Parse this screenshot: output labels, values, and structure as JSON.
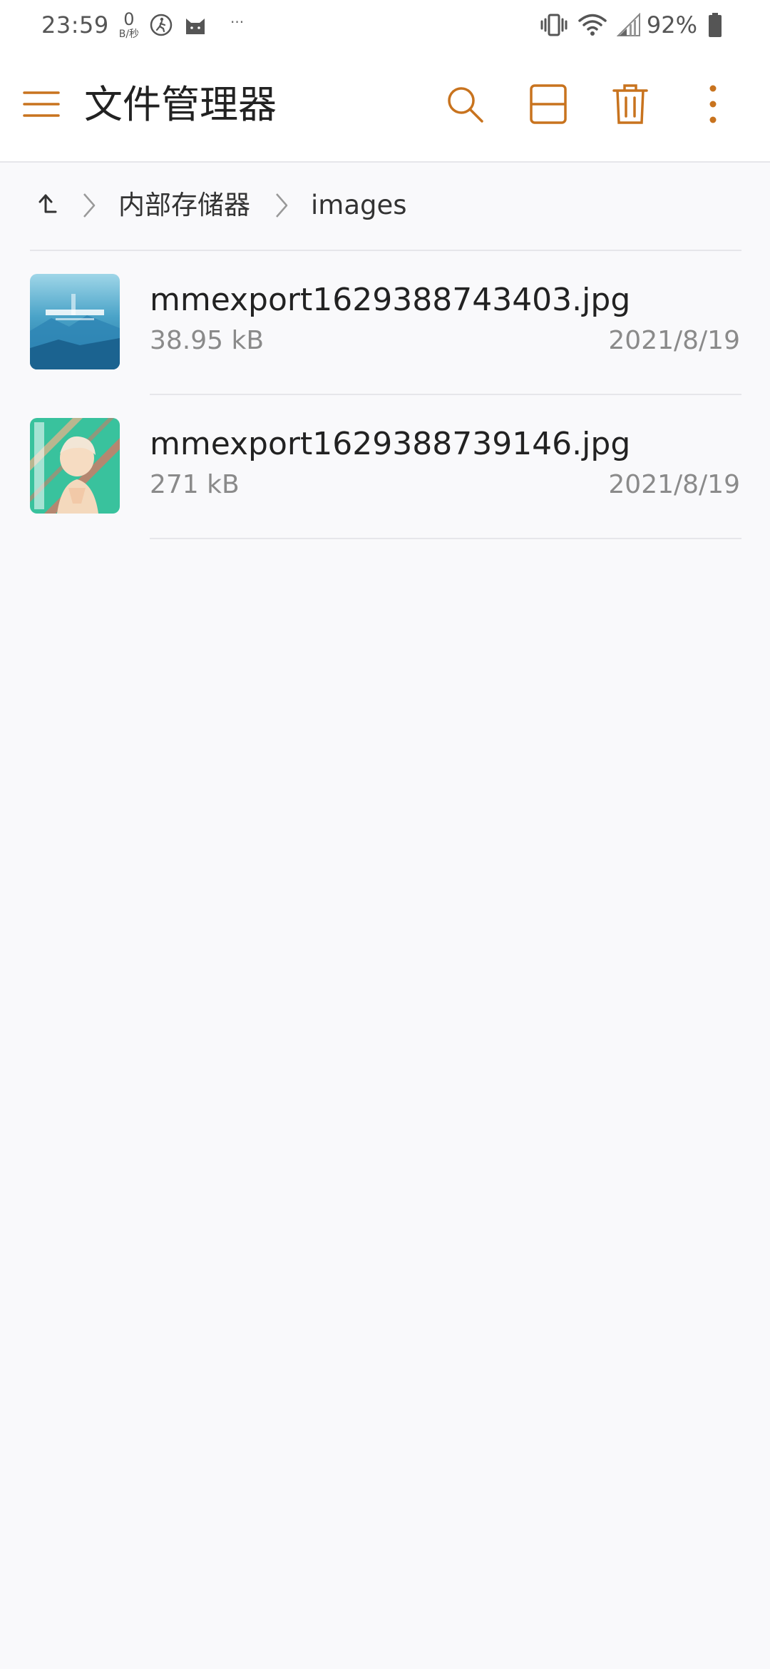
{
  "status_bar": {
    "time": "23:59",
    "net_speed_value": "0",
    "net_speed_unit": "B/秒",
    "more_dots": "···",
    "battery_percent": "92%"
  },
  "app_bar": {
    "title": "文件管理器"
  },
  "breadcrumb": {
    "items": [
      "内部存储器",
      "images"
    ]
  },
  "files": [
    {
      "name": "mmexport1629388743403.jpg",
      "size": "38.95 kB",
      "date": "2021/8/19"
    },
    {
      "name": "mmexport1629388739146.jpg",
      "size": "271 kB",
      "date": "2021/8/19"
    }
  ],
  "colors": {
    "accent": "#c8731e",
    "text_primary": "#222222",
    "text_secondary": "#8a8a8a",
    "background": "#f9f9fb",
    "divider": "#e6e6ea"
  },
  "icons": {
    "menu": "hamburger-menu-icon",
    "search": "search-icon",
    "view": "split-view-icon",
    "delete": "trash-icon",
    "more": "more-vert-icon",
    "up": "arrow-up-icon",
    "separator": "chevron-right-icon"
  }
}
